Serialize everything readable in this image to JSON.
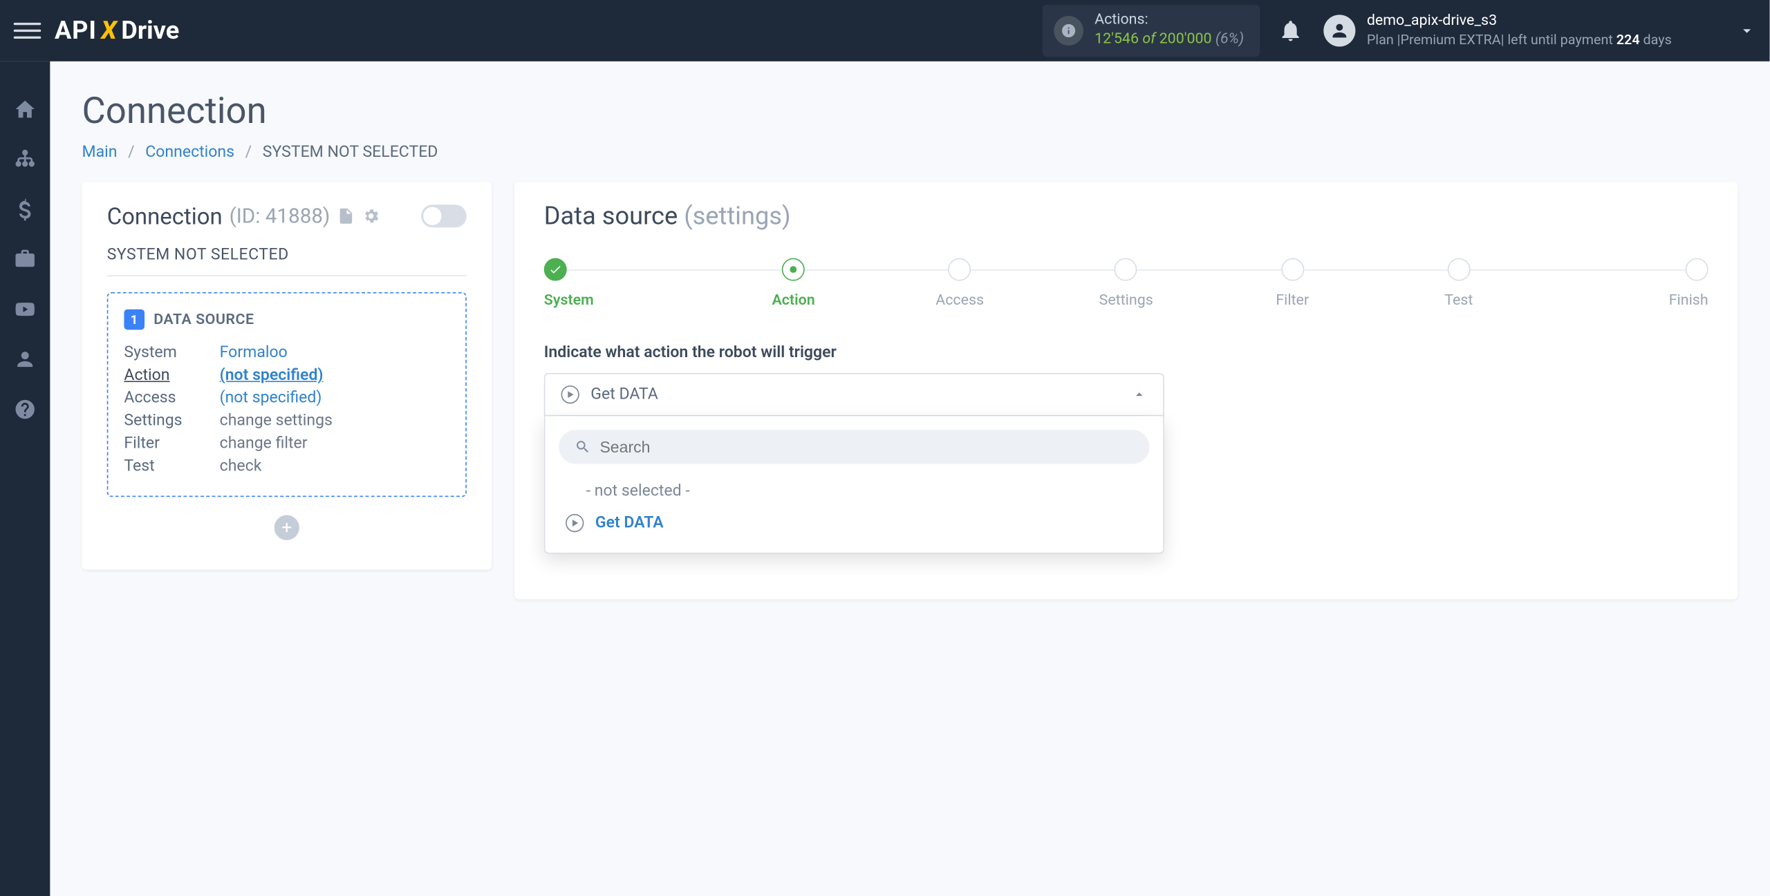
{
  "brand": {
    "api": "API",
    "x": "X",
    "drive": "Drive"
  },
  "header": {
    "actions": {
      "label": "Actions:",
      "count": "12'546",
      "of": "of",
      "total": "200'000",
      "pct": "(6%)"
    },
    "user": {
      "name": "demo_apix-drive_s3",
      "plan_prefix": "Plan |",
      "plan_name": "Premium EXTRA",
      "plan_mid": "| left until payment",
      "days_num": "224",
      "days_word": "days"
    }
  },
  "page": {
    "title": "Connection"
  },
  "breadcrumb": {
    "main": "Main",
    "connections": "Connections",
    "current": "SYSTEM NOT SELECTED"
  },
  "left": {
    "heading": "Connection",
    "id": "(ID: 41888)",
    "sub": "SYSTEM NOT SELECTED",
    "ds_badge": "1",
    "ds_title": "DATA SOURCE",
    "rows": [
      {
        "k": "System",
        "v": "Formaloo",
        "link": true,
        "active": false
      },
      {
        "k": "Action",
        "v": "(not specified)",
        "link": true,
        "active": true
      },
      {
        "k": "Access",
        "v": "(not specified)",
        "link": true,
        "active": false
      },
      {
        "k": "Settings",
        "v": "change settings",
        "link": false,
        "active": false
      },
      {
        "k": "Filter",
        "v": "change filter",
        "link": false,
        "active": false
      },
      {
        "k": "Test",
        "v": "check",
        "link": false,
        "active": false
      }
    ]
  },
  "right": {
    "heading": "Data source",
    "settings": "(settings)",
    "steps": [
      "System",
      "Action",
      "Access",
      "Settings",
      "Filter",
      "Test",
      "Finish"
    ],
    "step_done": 0,
    "step_current": 1,
    "field_label": "Indicate what action the robot will trigger",
    "selected": "Get DATA",
    "search_placeholder": "Search",
    "opt_none": "- not selected -",
    "opt_get": "Get DATA"
  }
}
